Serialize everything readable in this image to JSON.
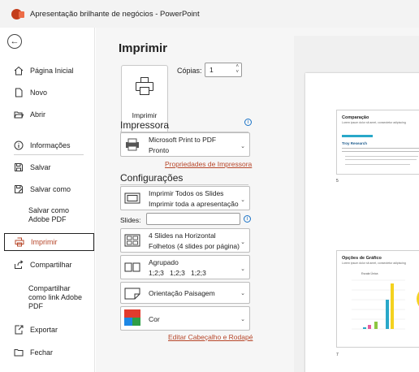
{
  "window": {
    "title": "Apresentação brilhante de negócios  -  PowerPoint"
  },
  "sidebar": {
    "back_icon": "arrow-left-icon",
    "items": [
      {
        "label": "Página Inicial",
        "icon": "home-icon"
      },
      {
        "label": "Novo",
        "icon": "new-file-icon"
      },
      {
        "label": "Abrir",
        "icon": "folder-open-icon"
      },
      {
        "label": "Informações",
        "icon": "info-icon"
      },
      {
        "label": "Salvar",
        "icon": "save-icon"
      },
      {
        "label": "Salvar como",
        "icon": "save-as-icon"
      },
      {
        "label_line1": "Salvar como",
        "label_line2": "Adobe PDF"
      },
      {
        "label": "Imprimir",
        "icon": "printer-icon",
        "active": true
      },
      {
        "label": "Compartilhar",
        "icon": "share-icon"
      },
      {
        "label_line1": "Compartilhar",
        "label_line2": "como link Adobe",
        "label_line3": "PDF"
      },
      {
        "label": "Exportar",
        "icon": "export-icon"
      },
      {
        "label": "Fechar",
        "icon": "close-folder-icon"
      }
    ]
  },
  "print": {
    "title": "Imprimir",
    "button_label": "Imprimir",
    "copies_label": "Cópias:",
    "copies_value": "1",
    "printer_section": "Impressora",
    "printer_name": "Microsoft Print to PDF",
    "printer_status": "Pronto",
    "printer_properties_link": "Propriedades de Impressora",
    "settings_section": "Configurações",
    "range_line1": "Imprimir Todos os Slides",
    "range_line2": "Imprimir toda a apresentação",
    "slides_label": "Slides:",
    "slides_value": "",
    "layout_line1": "4 Slides na Horizontal",
    "layout_line2": "Folhetos (4 slides por página)",
    "collate_line1": "Agrupado",
    "collate_line2": "1;2;3   1;2;3   1;2;3",
    "orientation": "Orientação Paisagem",
    "color": "Cor",
    "header_footer_link": "Editar Cabeçalho e Rodapé"
  },
  "preview": {
    "slides": [
      {
        "number": "5",
        "title": "Comparação",
        "subtitle": "Lorem ipsum dolor sit amet, consectetur adipiscing",
        "heading": "Troy Research"
      },
      {
        "number": "7",
        "title": "Opções de Gráfico",
        "subtitle": "Lorem ipsum dolor sit amet, consectetur adipiscing",
        "chart_label": "Escala Única"
      }
    ]
  },
  "colors": {
    "accent": "#b7472a",
    "brand": "#c43e1c",
    "info": "#1a73c7"
  }
}
